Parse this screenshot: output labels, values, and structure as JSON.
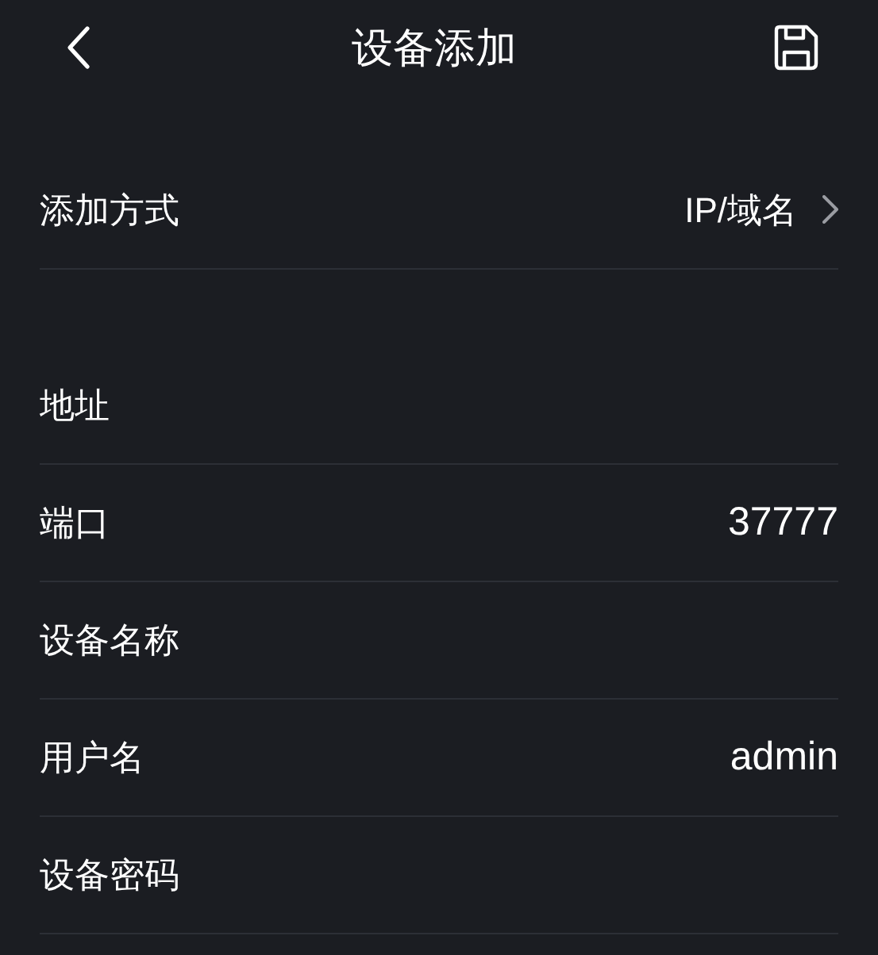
{
  "header": {
    "title": "设备添加"
  },
  "method": {
    "label": "添加方式",
    "value": "IP/域名"
  },
  "fields": [
    {
      "label": "地址"
    },
    {
      "label": "端口",
      "value": "37777"
    },
    {
      "label": "设备名称"
    },
    {
      "label": "用户名",
      "value": "admin"
    },
    {
      "label": "设备密码"
    }
  ]
}
